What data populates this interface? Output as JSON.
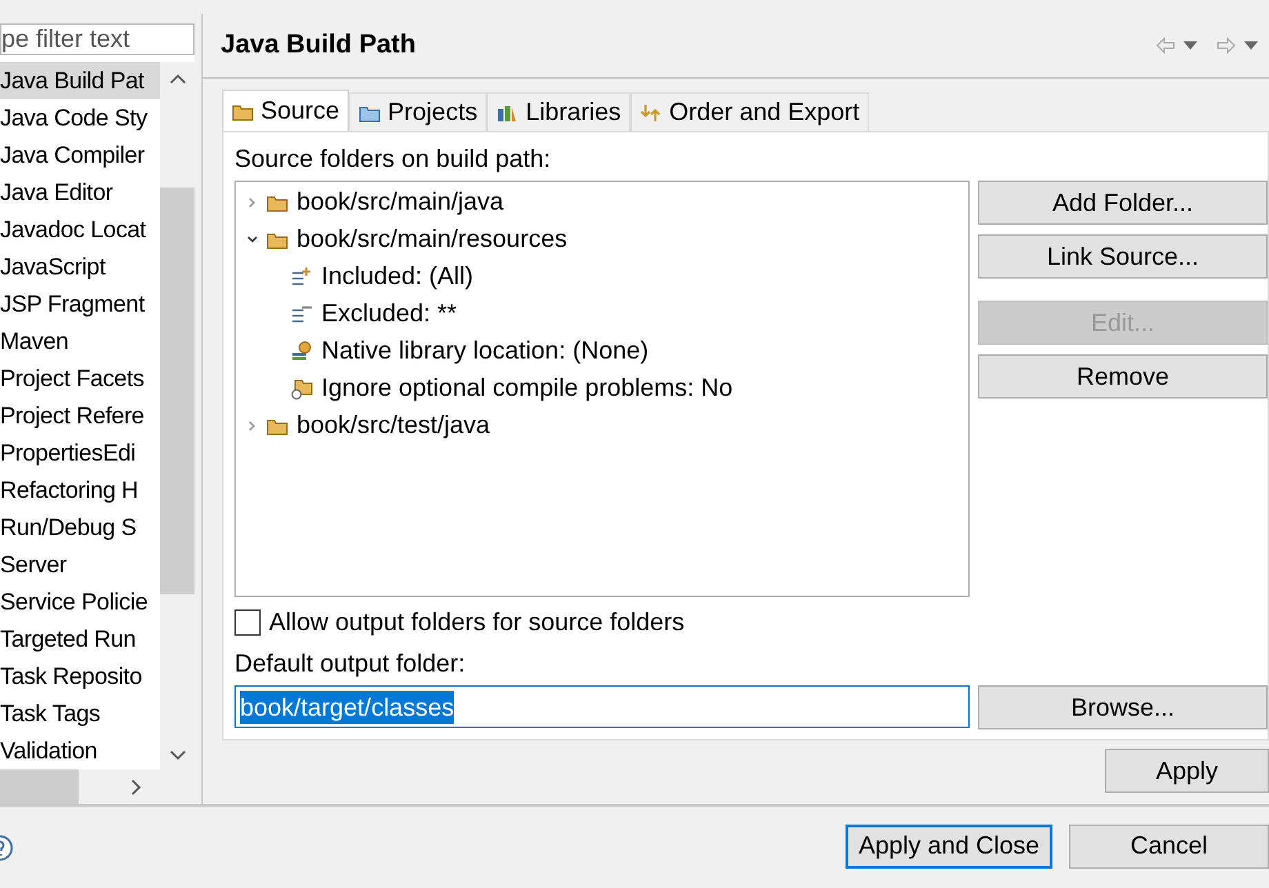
{
  "filter": {
    "placeholder": "pe filter text"
  },
  "nav_items": [
    {
      "label": "Java Build Pat",
      "selected": true
    },
    {
      "label": "Java Code Sty",
      "selected": false
    },
    {
      "label": "Java Compiler",
      "selected": false
    },
    {
      "label": "Java Editor",
      "selected": false
    },
    {
      "label": "Javadoc Locat",
      "selected": false
    },
    {
      "label": "JavaScript",
      "selected": false
    },
    {
      "label": "JSP Fragment",
      "selected": false
    },
    {
      "label": "Maven",
      "selected": false
    },
    {
      "label": "Project Facets",
      "selected": false
    },
    {
      "label": "Project Refere",
      "selected": false
    },
    {
      "label": "PropertiesEdi",
      "selected": false
    },
    {
      "label": "Refactoring H",
      "selected": false
    },
    {
      "label": "Run/Debug S",
      "selected": false
    },
    {
      "label": "Server",
      "selected": false
    },
    {
      "label": "Service Policie",
      "selected": false
    },
    {
      "label": "Targeted Run",
      "selected": false
    },
    {
      "label": "Task Reposito",
      "selected": false
    },
    {
      "label": "Task Tags",
      "selected": false
    },
    {
      "label": "Validation",
      "selected": false
    }
  ],
  "page_title": "Java Build Path",
  "tabs": [
    {
      "label": "Source",
      "kind": "source",
      "selected": true
    },
    {
      "label": "Projects",
      "kind": "projects",
      "selected": false
    },
    {
      "label": "Libraries",
      "kind": "libraries",
      "selected": false
    },
    {
      "label": "Order and Export",
      "kind": "order",
      "selected": false
    }
  ],
  "tree_label": "Source folders on build path:",
  "tree": [
    {
      "label": "book/src/main/java",
      "kind": "folder",
      "expanded": false
    },
    {
      "label": "book/src/main/resources",
      "kind": "folder",
      "expanded": true,
      "children": [
        {
          "label": "Included: (All)",
          "kind": "included"
        },
        {
          "label": "Excluded: **",
          "kind": "excluded"
        },
        {
          "label": "Native library location: (None)",
          "kind": "native"
        },
        {
          "label": "Ignore optional compile problems: No",
          "kind": "ignore"
        }
      ]
    },
    {
      "label": "book/src/test/java",
      "kind": "folder",
      "expanded": false
    }
  ],
  "side_buttons": [
    {
      "label": "Add Folder...",
      "disabled": false
    },
    {
      "label": "Link Source...",
      "disabled": false
    },
    {
      "label": "Edit...",
      "disabled": true
    },
    {
      "label": "Remove",
      "disabled": false
    }
  ],
  "allow_output": {
    "label": "Allow output folders for source folders",
    "checked": false
  },
  "output_label": "Default output folder:",
  "output_value": "book/target/classes",
  "browse_button": "Browse...",
  "apply_button": "Apply",
  "footer_buttons": [
    {
      "label": "Apply and Close",
      "default": true
    },
    {
      "label": "Cancel",
      "default": false
    }
  ]
}
